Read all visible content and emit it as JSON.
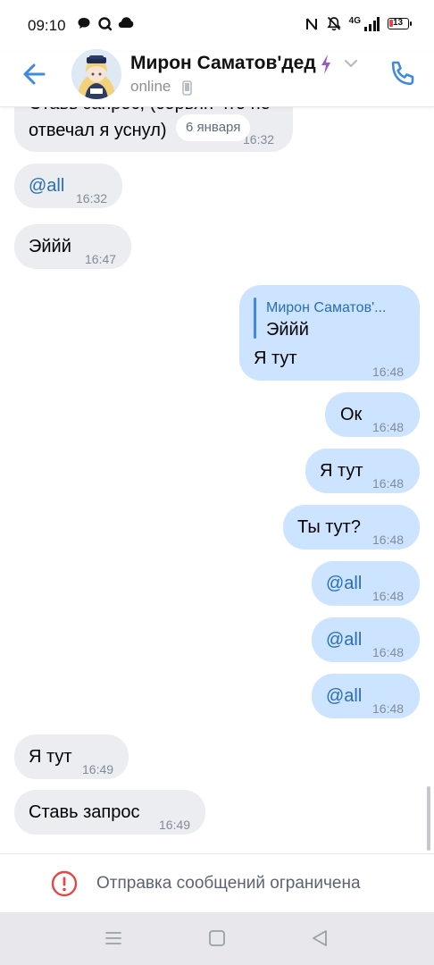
{
  "status_bar": {
    "time": "09:10",
    "network": "4G",
    "battery": "13",
    "icons": [
      "message-bubble-icon",
      "search-circle-icon",
      "cloud-icon",
      "nfc-icon",
      "mute-bell-icon",
      "signal-icon",
      "battery-icon"
    ]
  },
  "header": {
    "contact_name": "Мирон Саматов'дед",
    "status": "online",
    "accent": "#3f8ae0"
  },
  "chat": {
    "date_label": "6 января",
    "messages": [
      {
        "dir": "in",
        "text_line1": "Ставь запрос, (сорьян что не",
        "text_line2": "отвечал я уснул)",
        "time": "16:32"
      },
      {
        "dir": "in",
        "text": "@all",
        "time": "16:32"
      },
      {
        "dir": "in",
        "text": "Эййй",
        "time": "16:47"
      },
      {
        "dir": "out",
        "reply_name": "Мирон Саматов'...",
        "reply_text": "Эййй",
        "text": "Я тут",
        "time": "16:48"
      },
      {
        "dir": "out",
        "text": "Ок",
        "time": "16:48"
      },
      {
        "dir": "out",
        "text": "Я тут",
        "time": "16:48"
      },
      {
        "dir": "out",
        "text": "Ты тут?",
        "time": "16:48"
      },
      {
        "dir": "out",
        "text": "@all",
        "time": "16:48"
      },
      {
        "dir": "out",
        "text": "@all",
        "time": "16:48"
      },
      {
        "dir": "out",
        "text": "@all",
        "time": "16:48"
      },
      {
        "dir": "in",
        "text": "Я тут",
        "time": "16:49"
      },
      {
        "dir": "in",
        "text": "Ставь запрос",
        "time": "16:49"
      }
    ]
  },
  "restricted": {
    "text": "Отправка сообщений ограничена",
    "color": "#e64646"
  },
  "navbar": {
    "buttons": [
      "menu-icon",
      "home-square-icon",
      "back-triangle-icon"
    ]
  }
}
